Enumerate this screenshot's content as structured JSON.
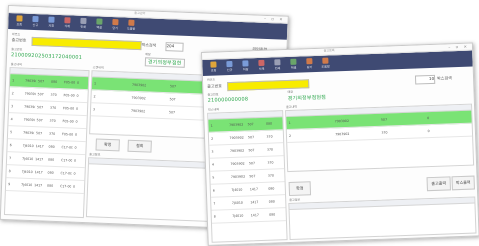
{
  "colors": {
    "toolbar": "#3f4a73",
    "highlight": "#f8ec00",
    "selected_row": "#7ae375",
    "green_text": "#2aa64a"
  },
  "window1": {
    "title": "출고관리",
    "toolbar": [
      {
        "label": "조회",
        "icon": "search-icon",
        "color": "#e0a53a"
      },
      {
        "label": "신규",
        "icon": "new-icon",
        "color": "#7a9bd8"
      },
      {
        "label": "저장",
        "icon": "save-icon",
        "color": "#7a9bd8"
      },
      {
        "label": "삭제",
        "icon": "delete-icon",
        "color": "#c66"
      },
      {
        "label": "인쇄",
        "icon": "print-icon",
        "color": "#9a9fb5"
      },
      {
        "label": "엑셀",
        "icon": "excel-icon",
        "color": "#6aa56a"
      },
      {
        "label": "닫기",
        "icon": "close-icon",
        "color": "#d07a4a"
      },
      {
        "label": "도움말",
        "icon": "help-icon",
        "color": "#d07a4a"
      }
    ],
    "barcode_label": "바코드",
    "field_label": "출고번호",
    "box_label": "박스검색",
    "box_value": "204",
    "right_button": "리턴출력",
    "code_label": "출고번호",
    "code_value": "210009202503172040001",
    "store_label": "매장",
    "store_value": "경기의정부점현",
    "left_grid_label": "출고내역",
    "left_rows": [
      [
        "1",
        "7903902",
        "507",
        "080",
        "F05-00-",
        "0"
      ],
      [
        "2",
        "7903902",
        "507",
        "370",
        "F05-00-",
        "0"
      ],
      [
        "3",
        "7903902",
        "507",
        "370",
        "F05-00-",
        "0"
      ],
      [
        "4",
        "7903902",
        "507",
        "370",
        "F05-00-",
        "0"
      ],
      [
        "5",
        "7903902",
        "507",
        "370",
        "F05-00-",
        "0"
      ],
      [
        "6",
        "7J4010",
        "1417",
        "080",
        "C17-00-",
        "0"
      ],
      [
        "7",
        "7J4010",
        "1417",
        "080",
        "C17-00-",
        "0"
      ],
      [
        "8",
        "7J4010",
        "1417",
        "080",
        "C17-00-",
        "0"
      ],
      [
        "9",
        "7J4010",
        "1417",
        "080",
        "C17-00-",
        "0"
      ]
    ],
    "right_grid_label": "스캔내역",
    "right_rows": [
      [
        "1",
        "7903902",
        "507",
        "080",
        "0"
      ],
      [
        "2",
        "7903902",
        "507",
        "370",
        "0"
      ],
      [
        "3",
        "7903902",
        "507",
        "370",
        "0"
      ]
    ],
    "btn_confirm": "확정",
    "btn_cancel": "철회",
    "bottom_label": "출고정보"
  },
  "window2": {
    "title": "출고등록",
    "toolbar": [
      {
        "label": "조회",
        "icon": "search-icon",
        "color": "#e0a53a"
      },
      {
        "label": "신규",
        "icon": "new-icon",
        "color": "#7a9bd8"
      },
      {
        "label": "저장",
        "icon": "save-icon",
        "color": "#7a9bd8"
      },
      {
        "label": "삭제",
        "icon": "delete-icon",
        "color": "#c66"
      },
      {
        "label": "인쇄",
        "icon": "print-icon",
        "color": "#9a9fb5"
      },
      {
        "label": "엑셀",
        "icon": "excel-icon",
        "color": "#6aa56a"
      },
      {
        "label": "닫기",
        "icon": "close-icon",
        "color": "#d07a4a"
      },
      {
        "label": "도움말",
        "icon": "help-icon",
        "color": "#d07a4a"
      }
    ],
    "barcode_label": "바코드",
    "field_label": "출고번호",
    "qty_value": "10",
    "qty_label": "박스검색",
    "code_label": "출고번호",
    "code_value": "210000000008",
    "store_label": "매장",
    "store_value": "경기의정부점현점",
    "left_grid_label": "박스내역",
    "left_rows": [
      [
        "1",
        "7903902",
        "507",
        "080"
      ],
      [
        "2",
        "7903902",
        "507",
        "370"
      ],
      [
        "3",
        "7903902",
        "507",
        "370"
      ],
      [
        "4",
        "7903902",
        "507",
        "370"
      ],
      [
        "5",
        "7903902",
        "507",
        "370"
      ],
      [
        "6",
        "7J4010",
        "1417",
        "080"
      ],
      [
        "7",
        "7J4010",
        "1417",
        "080"
      ],
      [
        "8",
        "7J4010",
        "1417",
        "080"
      ]
    ],
    "right_grid_label": "출고내역",
    "right_rows": [
      [
        "1",
        "7903902",
        "507",
        "0"
      ],
      [
        "2",
        "7903902",
        "370",
        "0"
      ]
    ],
    "btn_mid": "확정",
    "btn_print": "출고출력",
    "btn_box": "박스출력",
    "bottom_label": "출고정보"
  }
}
